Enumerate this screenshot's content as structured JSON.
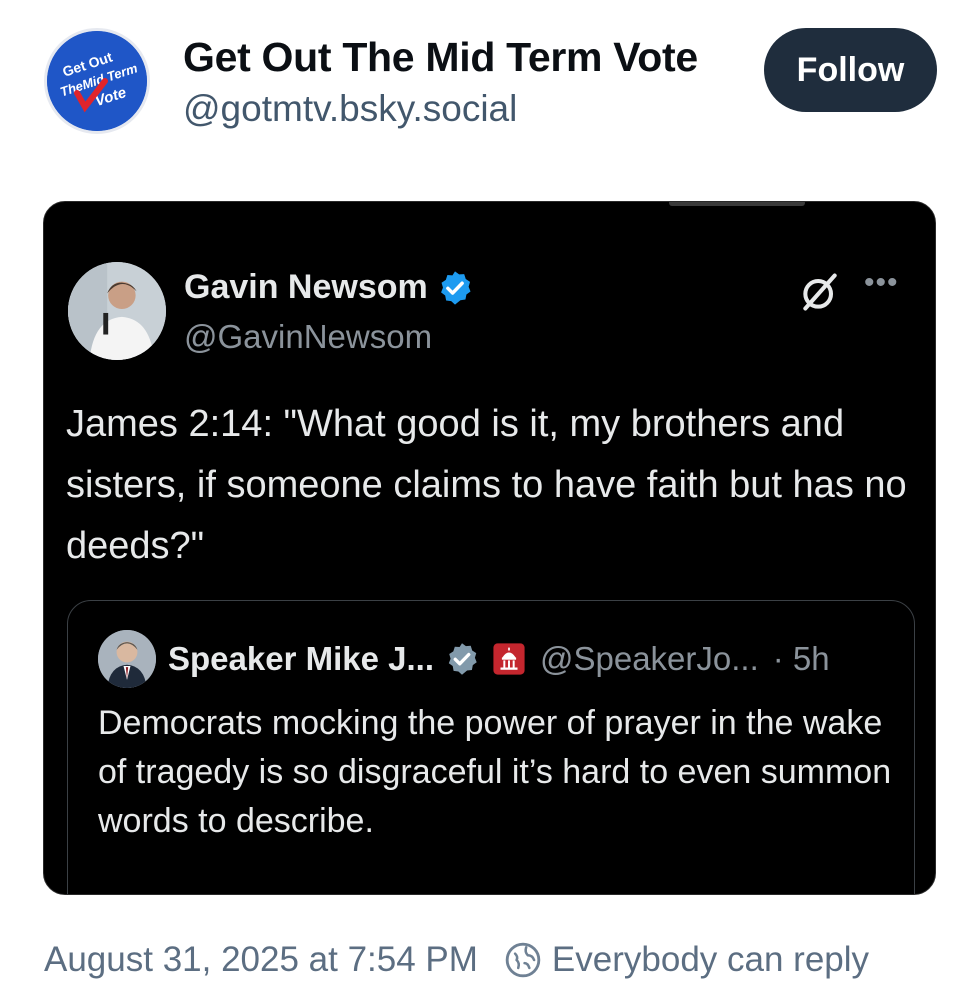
{
  "post": {
    "author": {
      "name": "Get Out The Mid Term Vote",
      "handle": "@gotmtv.bsky.social",
      "avatar_text": [
        "Get Out",
        "TheMid Term",
        "Vote"
      ]
    },
    "follow_label": "Follow",
    "timestamp": "August 31, 2025 at 7:54 PM",
    "reply_setting": "Everybody can reply",
    "reply_icon": "globe-reply-icon"
  },
  "embedded_tweet": {
    "author_name": "Gavin Newsom",
    "author_handle": "@GavinNewsom",
    "verified_icon": "verified-badge-icon",
    "text": "James 2:14: \"What good is it, my brothers and sisters, if someone claims to have faith but has no deeds?\"",
    "quoted": {
      "author_name": "Speaker Mike J...",
      "author_handle": "@SpeakerJo...",
      "time": "· 5h",
      "text": "Democrats mocking the power of prayer in the wake of tragedy is so disgraceful it’s hard to even summon words to describe."
    }
  },
  "colors": {
    "follow_button_bg": "#1f2d3d",
    "verified_blue": "#1d9bf0",
    "card_bg": "#000000",
    "footer_text": "#5c6e82"
  }
}
